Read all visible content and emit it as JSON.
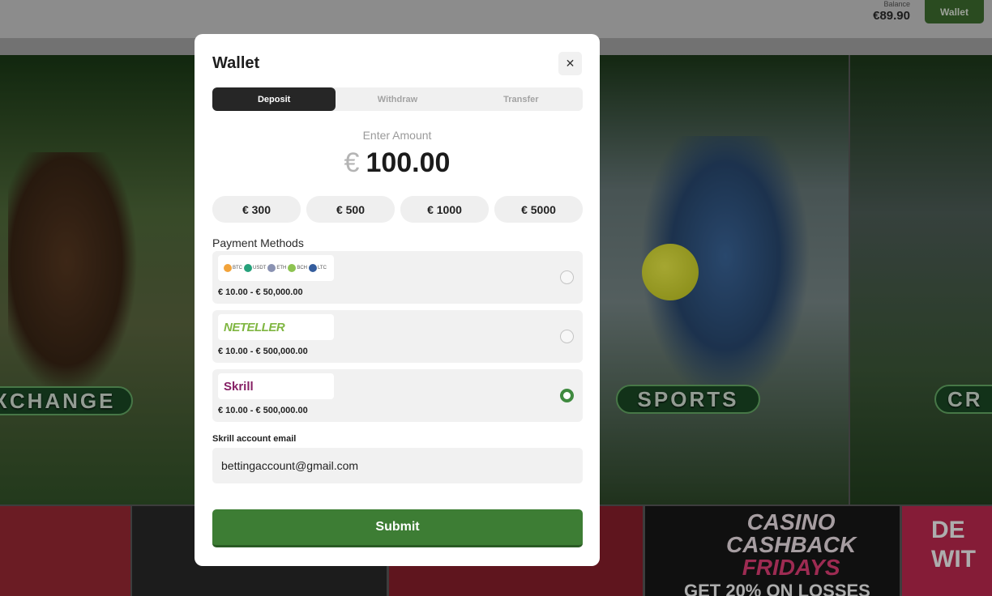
{
  "header": {
    "balance_label": "Balance",
    "balance_value": "€89.90",
    "wallet_button": "Wallet"
  },
  "background": {
    "tiles": [
      "XCHANGE",
      "SPORTS",
      "CR"
    ],
    "promo_casino": [
      "CASINO",
      "CASHBACK",
      "FRIDAYS"
    ],
    "promo_casino_sub": "GET 20% ON LOSSES",
    "promo_right": [
      "DE",
      "WIT"
    ]
  },
  "modal": {
    "title": "Wallet",
    "close_icon": "close-icon",
    "tabs": [
      {
        "label": "Deposit",
        "active": true
      },
      {
        "label": "Withdraw",
        "active": false
      },
      {
        "label": "Transfer",
        "active": false
      }
    ],
    "amount_label": "Enter Amount",
    "currency_symbol": "€",
    "amount_value": "100.00",
    "presets": [
      "€ 300",
      "€ 500",
      "€ 1000",
      "€ 5000"
    ],
    "payment_methods_title": "Payment Methods",
    "methods": [
      {
        "name": "Crypto",
        "coins": [
          "BTC",
          "USDT",
          "ETH",
          "BCH",
          "LTC"
        ],
        "coin_colors": [
          "#f2a33a",
          "#26a17b",
          "#8a92b2",
          "#8dc351",
          "#345d9d"
        ],
        "limit": "€ 10.00 - € 50,000.00",
        "selected": false
      },
      {
        "name": "NETELLER",
        "limit": "€ 10.00 - € 500,000.00",
        "selected": false
      },
      {
        "name": "Skrill",
        "limit": "€ 10.00 - € 500,000.00",
        "selected": true
      }
    ],
    "email_label": "Skrill account email",
    "email_value": "bettingaccount@gmail.com",
    "submit_label": "Submit"
  },
  "colors": {
    "accent_green": "#3d7d34",
    "tab_active": "#262626"
  }
}
